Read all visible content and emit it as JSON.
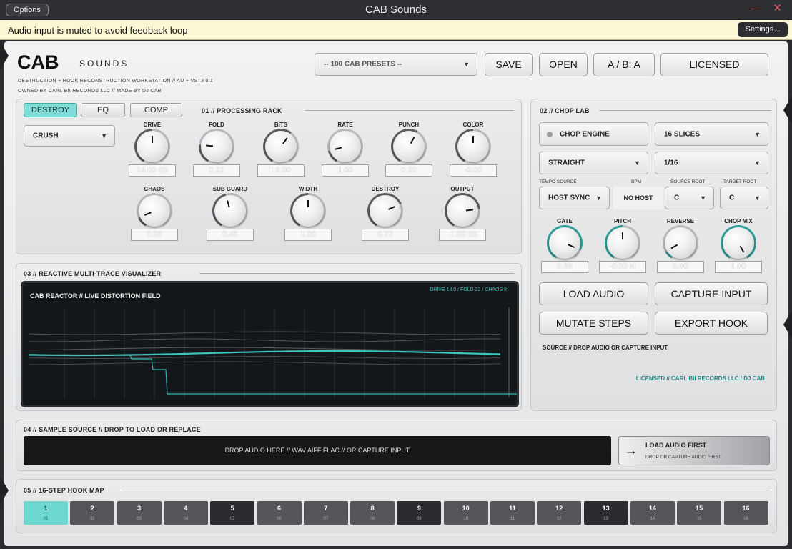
{
  "window": {
    "title": "CAB Sounds",
    "options_label": "Options",
    "minimize_glyph": "—",
    "close_glyph": "✕"
  },
  "mute_bar": {
    "message": "Audio input is muted to avoid feedback loop",
    "settings_label": "Settings..."
  },
  "header": {
    "logo_main": "CAB",
    "logo_sub": "SOUNDS",
    "tagline": "DESTRUCTION + HOOK RECONSTRUCTION WORKSTATION  //  AU + VST3 0.1",
    "credits": "OWNED BY CARL BII RECORDS LLC  //  MADE BY DJ CAB",
    "preset_placeholder": "-- 100 CAB PRESETS --",
    "buttons": {
      "save": "SAVE",
      "open": "OPEN",
      "ab": "A / B: A",
      "licensed": "LICENSED"
    }
  },
  "rack": {
    "title": "01 // PROCESSING RACK",
    "tabs": [
      {
        "label": "DESTROY",
        "active": true
      },
      {
        "label": "EQ",
        "active": false
      },
      {
        "label": "COMP",
        "active": false
      }
    ],
    "mode": "CRUSH",
    "row1": [
      {
        "label": "DRIVE",
        "value": "14.00 dB",
        "level": 0.5
      },
      {
        "label": "FOLD",
        "value": "0.22",
        "level": 0.22
      },
      {
        "label": "BITS",
        "value": "16.00",
        "level": 0.62
      },
      {
        "label": "RATE",
        "value": "1.00",
        "level": 0.15
      },
      {
        "label": "PUNCH",
        "value": "0.20",
        "level": 0.6
      },
      {
        "label": "COLOR",
        "value": "-0.00",
        "level": 0.5
      }
    ],
    "row2": [
      {
        "label": "CHAOS",
        "value": "0.08",
        "level": 0.12
      },
      {
        "label": "SUB GUARD",
        "value": "0.45",
        "level": 0.45
      },
      {
        "label": "WIDTH",
        "value": "1.00",
        "level": 0.5
      },
      {
        "label": "DESTROY",
        "value": "0.72",
        "level": 0.72
      },
      {
        "label": "OUTPUT",
        "value": "-1.00 dB",
        "level": 0.78
      }
    ]
  },
  "visualizer": {
    "title": "03 // REACTIVE MULTI-TRACE VISUALIZER",
    "screen_title": "CAB REACTOR  //  LIVE DISTORTION FIELD",
    "stats": "DRIVE 14.0  /  FOLD 22  /  CHAOS 8",
    "colors": {
      "trace": "#3cc7bd",
      "grid": "#2c3033",
      "bg": "#141719"
    }
  },
  "chop": {
    "title": "02 // CHOP LAB",
    "engine_label": "CHOP ENGINE",
    "slices": "16 SLICES",
    "pattern": "STRAIGHT",
    "division": "1/16",
    "tempo_source_label": "TEMPO SOURCE",
    "bpm_label": "BPM",
    "source_root_label": "SOURCE ROOT",
    "target_root_label": "TARGET ROOT",
    "tempo_source": "HOST SYNC",
    "bpm": "NO HOST",
    "source_root": "C",
    "target_root": "C",
    "knobs": [
      {
        "label": "GATE",
        "value": "0.88",
        "level": 0.88
      },
      {
        "label": "PITCH",
        "value": "-0.00 st",
        "level": 0.5
      },
      {
        "label": "REVERSE",
        "value": "0.00",
        "level": 0.1
      },
      {
        "label": "CHOP MIX",
        "value": "1.00",
        "level": 1.0
      }
    ],
    "buttons": {
      "load_audio": "LOAD AUDIO",
      "capture_input": "CAPTURE INPUT",
      "mutate_steps": "MUTATE STEPS",
      "export_hook": "EXPORT HOOK"
    },
    "source_status": "SOURCE // DROP AUDIO OR CAPTURE INPUT",
    "license_line": "LICENSED // CARL BII RECORDS LLC / DJ CAB"
  },
  "sample": {
    "title": "04 // SAMPLE SOURCE  //  DROP TO LOAD OR REPLACE",
    "drop_text": "DROP AUDIO HERE  //  WAV  AIFF  FLAC  //  OR CAPTURE INPUT",
    "load_first_title": "LOAD AUDIO FIRST",
    "load_first_sub": "DROP OR CAPTURE AUDIO FIRST"
  },
  "steps": {
    "title": "05 // 16-STEP HOOK MAP",
    "items": [
      {
        "num": "1",
        "sub": "01",
        "state": "active"
      },
      {
        "num": "2",
        "sub": "02",
        "state": "on"
      },
      {
        "num": "3",
        "sub": "03",
        "state": "on"
      },
      {
        "num": "4",
        "sub": "04",
        "state": "on"
      },
      {
        "num": "5",
        "sub": "05",
        "state": "accent"
      },
      {
        "num": "6",
        "sub": "06",
        "state": "on"
      },
      {
        "num": "7",
        "sub": "07",
        "state": "on"
      },
      {
        "num": "8",
        "sub": "08",
        "state": "on"
      },
      {
        "num": "9",
        "sub": "09",
        "state": "accent"
      },
      {
        "num": "10",
        "sub": "10",
        "state": "on"
      },
      {
        "num": "11",
        "sub": "11",
        "state": "on"
      },
      {
        "num": "12",
        "sub": "12",
        "state": "on"
      },
      {
        "num": "13",
        "sub": "13",
        "state": "accent"
      },
      {
        "num": "14",
        "sub": "14",
        "state": "on"
      },
      {
        "num": "15",
        "sub": "15",
        "state": "on"
      },
      {
        "num": "16",
        "sub": "16",
        "state": "on"
      }
    ]
  },
  "colors": {
    "accent": "#3cc7bd",
    "active_step": "#6fd8d1",
    "step_on": "#545659",
    "step_accent": "#2a2c2f"
  },
  "icons": {
    "arrow": "arrow-right-icon",
    "dropdown": "chevron-down-icon",
    "engine_led": "led-dot-icon"
  }
}
